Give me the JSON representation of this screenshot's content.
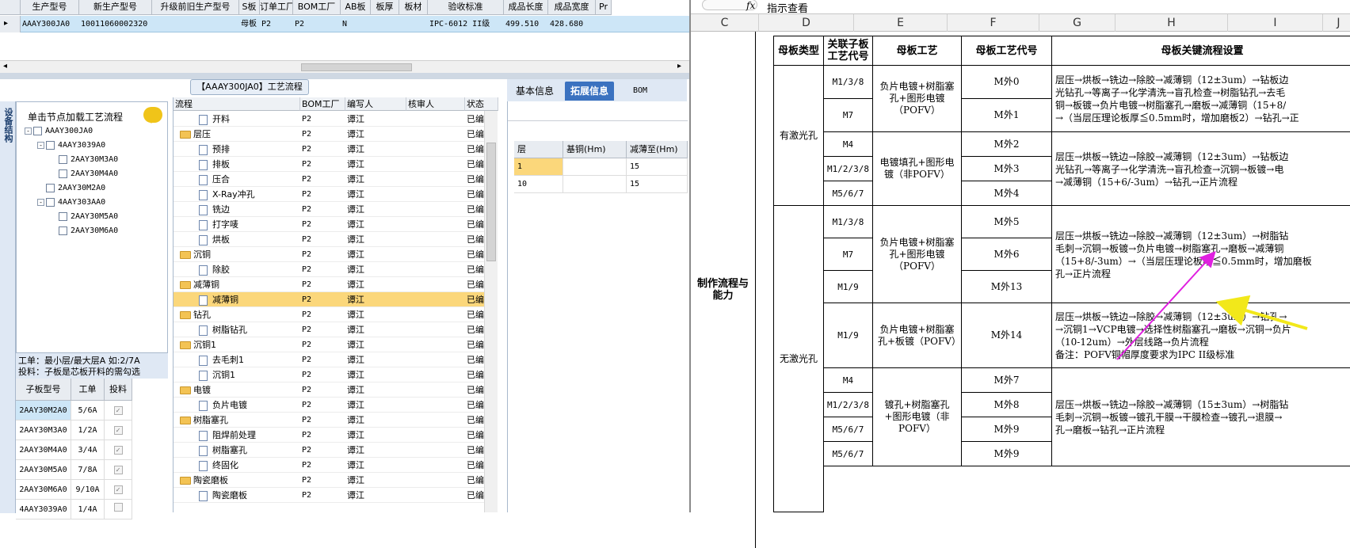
{
  "top_grid": {
    "headers": [
      "生产型号",
      "新生产型号",
      "升级前旧生产型号",
      "S板",
      "订单工厂",
      "BOM工厂",
      "AB板",
      "板厚",
      "板材",
      "验收标准",
      "成品长度",
      "成品宽度",
      "Pr"
    ],
    "row": [
      "AAAY300JA0",
      "10011060002320",
      "",
      "母板",
      "P2",
      "P2",
      "N",
      "",
      "",
      "IPC-6012 II级",
      "499.510",
      "428.680",
      ""
    ]
  },
  "sidebar": {
    "vertical_tab": "设备结构",
    "tree_title": "单击节点加载工艺流程",
    "tree": [
      {
        "label": "AAAY300JA0",
        "level": 0,
        "pm": "-"
      },
      {
        "label": "4AAY3039A0",
        "level": 1,
        "pm": "-"
      },
      {
        "label": "2AAY30M3A0",
        "level": 2,
        "pm": ""
      },
      {
        "label": "2AAY30M4A0",
        "level": 2,
        "pm": ""
      },
      {
        "label": "2AAY30M2A0",
        "level": 1,
        "pm": ""
      },
      {
        "label": "4AAY303AA0",
        "level": 1,
        "pm": "-"
      },
      {
        "label": "2AAY30M5A0",
        "level": 2,
        "pm": ""
      },
      {
        "label": "2AAY30M6A0",
        "level": 2,
        "pm": ""
      }
    ],
    "info_line1": "工单：最小层/最大层A 如:2/7A",
    "info_line2": "投料：子板是芯板开料的需勾选",
    "sub_headers": [
      "子板型号",
      "工单",
      "投料"
    ],
    "sub_rows": [
      {
        "model": "2AAY30M2A0",
        "order": "5/6A",
        "checked": "✓"
      },
      {
        "model": "2AAY30M3A0",
        "order": "1/2A",
        "checked": "✓"
      },
      {
        "model": "2AAY30M4A0",
        "order": "3/4A",
        "checked": "✓"
      },
      {
        "model": "2AAY30M5A0",
        "order": "7/8A",
        "checked": "✓"
      },
      {
        "model": "2AAY30M6A0",
        "order": "9/10A",
        "checked": "✓"
      },
      {
        "model": "4AAY3039A0",
        "order": "1/4A",
        "checked": ""
      }
    ]
  },
  "process": {
    "title": "【AAAY300JA0】工艺流程",
    "headers": [
      "流程",
      "BOM工厂",
      "编写人",
      "核审人",
      "状态"
    ],
    "rows": [
      {
        "name": "开料",
        "type": "doc",
        "bom": "P2",
        "author": "谭江",
        "status": "已编写"
      },
      {
        "name": "层压",
        "type": "folder",
        "bom": "P2",
        "author": "谭江",
        "status": "已编写"
      },
      {
        "name": "预排",
        "type": "doc",
        "bom": "P2",
        "author": "谭江",
        "status": "已编写"
      },
      {
        "name": "排板",
        "type": "doc",
        "bom": "P2",
        "author": "谭江",
        "status": "已编写"
      },
      {
        "name": "压合",
        "type": "doc",
        "bom": "P2",
        "author": "谭江",
        "status": "已编写"
      },
      {
        "name": "X-Ray冲孔",
        "type": "doc",
        "bom": "P2",
        "author": "谭江",
        "status": "已编写"
      },
      {
        "name": "铣边",
        "type": "doc",
        "bom": "P2",
        "author": "谭江",
        "status": "已编写"
      },
      {
        "name": "打字唛",
        "type": "doc",
        "bom": "P2",
        "author": "谭江",
        "status": "已编写"
      },
      {
        "name": "烘板",
        "type": "doc",
        "bom": "P2",
        "author": "谭江",
        "status": "已编写"
      },
      {
        "name": "沉铜",
        "type": "folder",
        "bom": "P2",
        "author": "谭江",
        "status": "已编写"
      },
      {
        "name": "除胶",
        "type": "doc",
        "bom": "P2",
        "author": "谭江",
        "status": "已编写"
      },
      {
        "name": "减薄铜",
        "type": "folder",
        "bom": "P2",
        "author": "谭江",
        "status": "已编写"
      },
      {
        "name": "减薄铜",
        "type": "doc",
        "bom": "P2",
        "author": "谭江",
        "status": "已编写",
        "selected": true
      },
      {
        "name": "钻孔",
        "type": "folder",
        "bom": "P2",
        "author": "谭江",
        "status": "已编写"
      },
      {
        "name": "树脂钻孔",
        "type": "doc",
        "bom": "P2",
        "author": "谭江",
        "status": "已编写"
      },
      {
        "name": "沉铜1",
        "type": "folder",
        "bom": "P2",
        "author": "谭江",
        "status": "已编写"
      },
      {
        "name": "去毛刺1",
        "type": "doc",
        "bom": "P2",
        "author": "谭江",
        "status": "已编写"
      },
      {
        "name": "沉铜1",
        "type": "doc",
        "bom": "P2",
        "author": "谭江",
        "status": "已编写"
      },
      {
        "name": "电镀",
        "type": "folder",
        "bom": "P2",
        "author": "谭江",
        "status": "已编写"
      },
      {
        "name": "负片电镀",
        "type": "doc",
        "bom": "P2",
        "author": "谭江",
        "status": "已编写"
      },
      {
        "name": "树脂塞孔",
        "type": "folder",
        "bom": "P2",
        "author": "谭江",
        "status": "已编写"
      },
      {
        "name": "阻焊前处理",
        "type": "doc",
        "bom": "P2",
        "author": "谭江",
        "status": "已编写"
      },
      {
        "name": "树脂塞孔",
        "type": "doc",
        "bom": "P2",
        "author": "谭江",
        "status": "已编写"
      },
      {
        "name": "终固化",
        "type": "doc",
        "bom": "P2",
        "author": "谭江",
        "status": "已编写"
      },
      {
        "name": "陶瓷磨板",
        "type": "folder",
        "bom": "P2",
        "author": "谭江",
        "status": "已编写"
      },
      {
        "name": "陶瓷磨板",
        "type": "doc",
        "bom": "P2",
        "author": "谭江",
        "status": "已编写"
      }
    ]
  },
  "tabs": [
    "基本信息",
    "拓展信息",
    "BOM"
  ],
  "ext_table": {
    "headers": [
      "层",
      "基铜(Hm)",
      "减薄至(Hm)"
    ],
    "rows": [
      [
        "1",
        "",
        "15"
      ],
      [
        "10",
        "",
        "15"
      ]
    ]
  },
  "sheet": {
    "formula_fx": "fx",
    "formula_text": "指示查看",
    "columns": [
      "C",
      "D",
      "E",
      "F",
      "G",
      "H",
      "I",
      "J"
    ],
    "headers": [
      "母板类型",
      "关联子板工艺代号",
      "母板工艺",
      "母板工艺代号",
      "母板关键流程设置"
    ],
    "left_label": "制作流程与能力",
    "type_laser": "有激光孔",
    "type_nolaser": "无激光孔",
    "codes": [
      "M1/3/8",
      "M7",
      "M4",
      "M1/2/3/8",
      "M5/6/7",
      "M1/3/8",
      "M7",
      "M1/9",
      "M1/9",
      "M4",
      "M1/2/3/8",
      "M5/6/7",
      "M5/6/7"
    ],
    "mcodes": [
      "M外0",
      "M外1",
      "M外2",
      "M外3",
      "M外4",
      "M外5",
      "M外6",
      "M外13",
      "M外14",
      "M外7",
      "M外8",
      "M外9",
      "M外9"
    ],
    "crafts": [
      "负片电镀+树脂塞孔+图形电镀（POFV）",
      "电镀填孔+图形电镀（非POFV）",
      "负片电镀+树脂塞孔+图形电镀（POFV）",
      "负片电镀+树脂塞孔+板镀（POFV）",
      "镀孔+树脂塞孔+图形电镀（非POFV）"
    ],
    "flow1": [
      "层压→烘板→铣边→除胶→减薄铜（12±3um）→钻板边",
      "光钻孔→等离子→化学清洗→盲孔检查→树脂钻孔→去毛",
      "铜→板镀→负片电镀→树脂塞孔→磨板→减薄铜（15+8/",
      "→（当层压理论板厚≦0.5mm时，增加磨板2）→钻孔→正"
    ],
    "flow2": [
      "层压→烘板→铣边→除胶→减薄铜（12±3um）→钻板边",
      "光钻孔→等离子→化学清洗→盲孔检查→沉铜→板镀→电",
      "→减薄铜（15+6/-3um）→钻孔→正片流程"
    ],
    "flow3": [
      "层压→烘板→铣边→除胶→减薄铜（12±3um）→树脂钻",
      "毛刺→沉铜→板镀→负片电镀→树脂塞孔→磨板→减薄铜",
      "（15+8/-3um）→（当层压理论板厚≦0.5mm时，增加磨板",
      "孔→正片流程"
    ],
    "flow4": [
      "层压→烘板→铣边→除胶→减薄铜（12±3um）→钻孔→",
      "→沉铜1→VCP电镀→选择性树脂塞孔→磨板→沉铜→负片",
      "（10-12um）→外层线路→负片流程",
      "备注：POFV铜帽厚度要求为IPC II级标准"
    ],
    "flow5": [
      "层压→烘板→铣边→除胶→减薄铜（15±3um）→树脂钻",
      "毛刺→沉铜→板镀→镀孔干膜→干膜检查→镀孔→退膜→",
      "孔→磨板→钻孔→正片流程"
    ],
    "colors": {
      "magenta_arrow": "#e020e0",
      "yellow_arrow": "#f2e81a"
    }
  }
}
